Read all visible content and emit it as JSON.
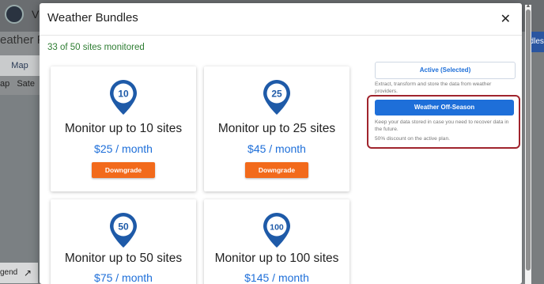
{
  "background": {
    "app_title": "V",
    "weather_heading": "eather F",
    "map_button": "Map",
    "layer_options": [
      "ap",
      "Sate"
    ],
    "legend_label": "gend",
    "right_button": "ndles"
  },
  "modal": {
    "title": "Weather Bundles",
    "close_label": "✕",
    "sites_status": "33 of 50 sites monitored",
    "cards": [
      {
        "pin_number": "10",
        "title": "Monitor up to 10 sites",
        "price": "$25 / month",
        "action": "Downgrade"
      },
      {
        "pin_number": "25",
        "title": "Monitor up to 25 sites",
        "price": "$45 / month",
        "action": "Downgrade"
      },
      {
        "pin_number": "50",
        "title": "Monitor up to 50 sites",
        "price": "$75 / month"
      },
      {
        "pin_number": "100",
        "title": "Monitor up to 100 sites",
        "price": "$145 / month"
      }
    ],
    "plans": {
      "active_label": "Active (Selected)",
      "active_desc": [
        "Extract, transform and store the data from weather",
        "providers."
      ],
      "offseason_label": "Weather Off-Season",
      "offseason_desc": [
        "Keep your data stored in case you need to recover data in",
        "the future."
      ],
      "offseason_discount": "50% discount on the active plan."
    }
  },
  "colors": {
    "accent_blue": "#1e6fd9",
    "downgrade_orange": "#f26a1b",
    "status_green": "#2e7d32",
    "highlight_red": "#a0242d",
    "pin_blue": "#1e5aa8"
  }
}
